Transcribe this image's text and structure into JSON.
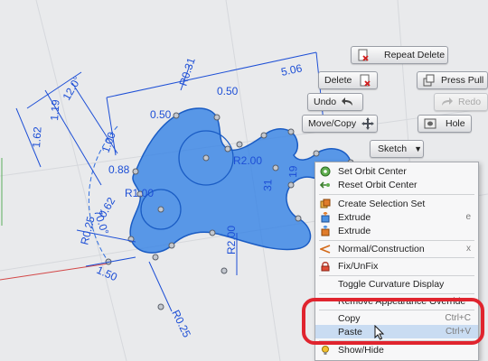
{
  "viewport": {
    "dimensions": [
      "5.06",
      "R0.31",
      "12.0°",
      "1.19",
      "1.62",
      "0.50",
      "0.50",
      "R2.00",
      "1.00",
      "0.88",
      "R1.00",
      "70.0°",
      "0.62",
      "R0.25",
      "1.50",
      "R2.00",
      "R0.25",
      "31",
      "19"
    ],
    "background_color": "#e9eaec",
    "sketch_color": "#2f7fe6",
    "dimension_color": "#1d4fd6"
  },
  "marking_menu": {
    "repeat_delete": "Repeat Delete",
    "delete": "Delete",
    "press_pull": "Press Pull",
    "undo": "Undo",
    "redo": "Redo",
    "move_copy": "Move/Copy",
    "hole": "Hole",
    "sketch": "Sketch"
  },
  "context_menu": {
    "items": [
      {
        "label": "Set Orbit Center",
        "icon": "orbit-center-icon"
      },
      {
        "label": "Reset Orbit Center",
        "icon": "reset-orbit-icon"
      },
      {
        "label": "Create Selection Set",
        "icon": "selection-set-icon"
      },
      {
        "label": "Extrude",
        "shortcut": "e",
        "icon": "extrude-icon"
      },
      {
        "label": "Extrude",
        "icon": "extrude-icon"
      },
      {
        "label": "Normal/Construction",
        "shortcut": "x",
        "icon": "normal-construction-icon"
      },
      {
        "label": "Fix/UnFix",
        "icon": "lock-icon"
      },
      {
        "label": "Toggle Curvature Display"
      },
      {
        "label": "Remove Appearance Override"
      },
      {
        "label": "Copy",
        "shortcut": "Ctrl+C"
      },
      {
        "label": "Paste",
        "shortcut": "Ctrl+V"
      },
      {
        "label": "Show/Hide",
        "icon": "bulb-icon"
      }
    ],
    "highlight_color": "#c9dcf2",
    "annotation_color": "#e0242e"
  }
}
